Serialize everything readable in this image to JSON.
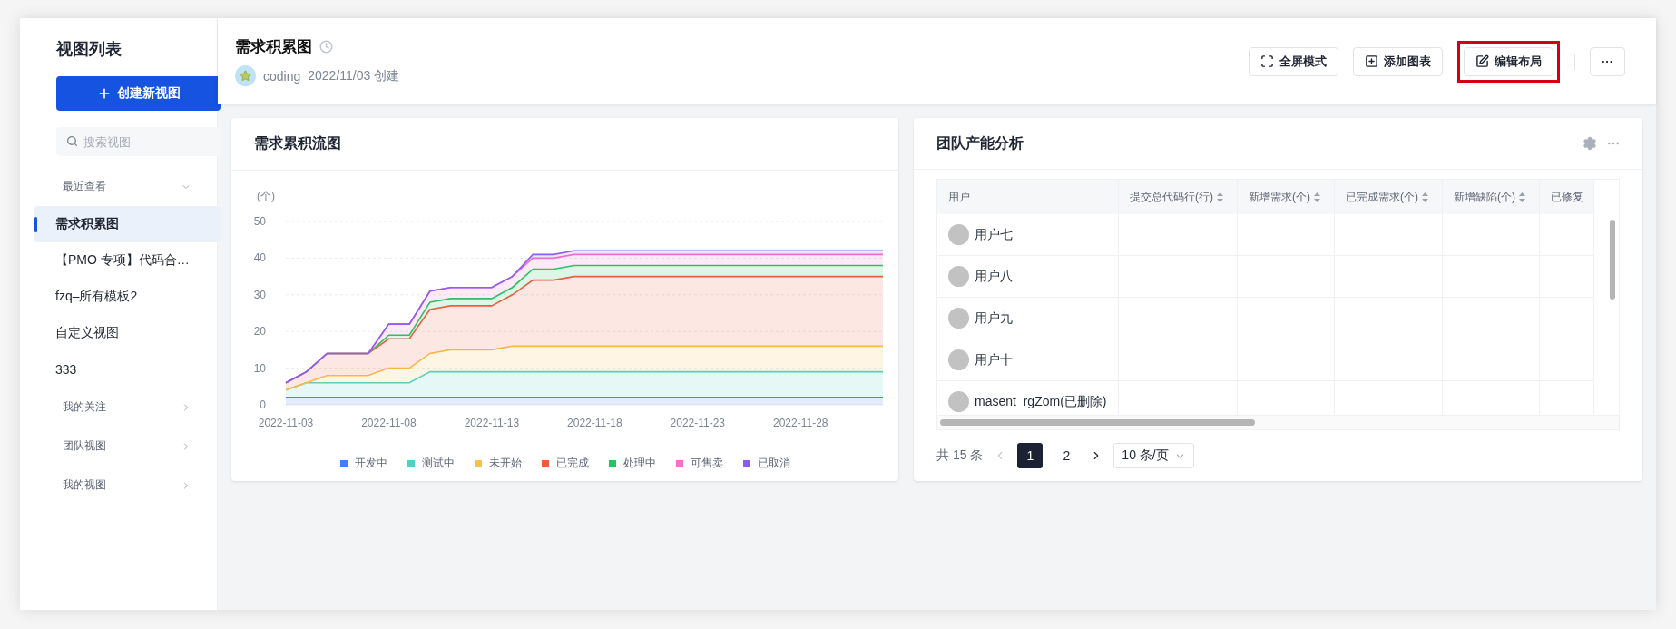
{
  "sidebar": {
    "title": "视图列表",
    "create_button": "创建新视图",
    "search": {
      "placeholder": "搜索视图"
    },
    "sections": [
      {
        "label": "最近查看",
        "expanded": true,
        "items": [
          {
            "label": "需求积累图",
            "selected": true
          },
          {
            "label": "【PMO 专项】代码合…",
            "selected": false
          },
          {
            "label": "fzq–所有模板2",
            "selected": false
          },
          {
            "label": "自定义视图",
            "selected": false
          },
          {
            "label": "333",
            "selected": false
          }
        ]
      },
      {
        "label": "我的关注",
        "expanded": false
      },
      {
        "label": "团队视图",
        "expanded": false
      },
      {
        "label": "我的视图",
        "expanded": false
      }
    ]
  },
  "header": {
    "title": "需求积累图",
    "author": "coding",
    "created": "2022/11/03 创建",
    "buttons": [
      {
        "kind": "fullscreen",
        "label": "全屏模式",
        "highlighted": false
      },
      {
        "kind": "add",
        "label": "添加图表",
        "highlighted": false
      },
      {
        "kind": "edit",
        "label": "编辑布局",
        "highlighted": true
      },
      {
        "kind": "more",
        "label": "···",
        "highlighted": false
      }
    ]
  },
  "chart_card": {
    "title": "需求累积流图",
    "chart_data": {
      "type": "area",
      "stacked": true,
      "grid": true,
      "ylabel": "(个)",
      "ylim": [
        0,
        50
      ],
      "yticks": [
        0,
        10,
        20,
        30,
        40,
        50
      ],
      "xlim": [
        "2022-11-03",
        "2022-12-02"
      ],
      "x": [
        "2022-11-03",
        "2022-11-04",
        "2022-11-05",
        "2022-11-06",
        "2022-11-07",
        "2022-11-08",
        "2022-11-09",
        "2022-11-10",
        "2022-11-11",
        "2022-11-12",
        "2022-11-13",
        "2022-11-14",
        "2022-11-15",
        "2022-11-16",
        "2022-11-17",
        "2022-11-18",
        "2022-11-19",
        "2022-11-20",
        "2022-11-21",
        "2022-11-22",
        "2022-11-23",
        "2022-11-24",
        "2022-11-25",
        "2022-11-26",
        "2022-11-27",
        "2022-11-28",
        "2022-11-29",
        "2022-11-30",
        "2022-12-01",
        "2022-12-02"
      ],
      "xticks": [
        "2022-11-03",
        "2022-11-08",
        "2022-11-13",
        "2022-11-18",
        "2022-11-23",
        "2022-11-28"
      ],
      "series": [
        {
          "name": "开发中",
          "color": "#3b82f6",
          "values": [
            2,
            2,
            2,
            2,
            2,
            2,
            2,
            2,
            2,
            2,
            2,
            2,
            2,
            2,
            2,
            2,
            2,
            2,
            2,
            2,
            2,
            2,
            2,
            2,
            2,
            2,
            2,
            2,
            2,
            2
          ]
        },
        {
          "name": "测试中",
          "color": "#4fd1c5",
          "values": [
            2,
            4,
            4,
            4,
            4,
            4,
            4,
            7,
            7,
            7,
            7,
            7,
            7,
            7,
            7,
            7,
            7,
            7,
            7,
            7,
            7,
            7,
            7,
            7,
            7,
            7,
            7,
            7,
            7,
            7
          ]
        },
        {
          "name": "未开始",
          "color": "#fbbf4a",
          "values": [
            0,
            0,
            2,
            2,
            2,
            4,
            4,
            5,
            6,
            6,
            6,
            7,
            7,
            7,
            7,
            7,
            7,
            7,
            7,
            7,
            7,
            7,
            7,
            7,
            7,
            7,
            7,
            7,
            7,
            7
          ]
        },
        {
          "name": "已完成",
          "color": "#f25c3c",
          "values": [
            2,
            3,
            6,
            6,
            6,
            8,
            8,
            12,
            12,
            12,
            12,
            14,
            18,
            18,
            19,
            19,
            19,
            19,
            19,
            19,
            19,
            19,
            19,
            19,
            19,
            19,
            19,
            19,
            19,
            19
          ]
        },
        {
          "name": "处理中",
          "color": "#22c55e",
          "values": [
            0,
            0,
            0,
            0,
            0,
            1,
            1,
            2,
            2,
            2,
            2,
            2,
            3,
            3,
            3,
            3,
            3,
            3,
            3,
            3,
            3,
            3,
            3,
            3,
            3,
            3,
            3,
            3,
            3,
            3
          ]
        },
        {
          "name": "可售卖",
          "color": "#f472c6",
          "values": [
            0,
            0,
            0,
            0,
            0,
            3,
            3,
            3,
            3,
            3,
            3,
            3,
            3,
            3,
            3,
            3,
            3,
            3,
            3,
            3,
            3,
            3,
            3,
            3,
            3,
            3,
            3,
            3,
            3,
            3
          ]
        },
        {
          "name": "已取消",
          "color": "#8b5cf6",
          "values": [
            0,
            0,
            0,
            0,
            0,
            0,
            0,
            0,
            0,
            0,
            0,
            0,
            1,
            1,
            1,
            1,
            1,
            1,
            1,
            1,
            1,
            1,
            1,
            1,
            1,
            1,
            1,
            1,
            1,
            1
          ]
        }
      ]
    }
  },
  "table_card": {
    "title": "团队产能分析",
    "columns": [
      {
        "label": "用户",
        "sortable": false
      },
      {
        "label": "提交总代码行(行)",
        "sortable": true
      },
      {
        "label": "新增需求(个)",
        "sortable": true
      },
      {
        "label": "已完成需求(个)",
        "sortable": true
      },
      {
        "label": "新增缺陷(个)",
        "sortable": true
      },
      {
        "label": "已修复"
      }
    ],
    "rows": [
      {
        "user": "用户七"
      },
      {
        "user": "用户八"
      },
      {
        "user": "用户九"
      },
      {
        "user": "用户十"
      },
      {
        "user": "masent_rgZom(已删除)"
      }
    ],
    "pagination": {
      "total": "共 15 条",
      "pages": [
        {
          "label": "1",
          "selected": true
        },
        {
          "label": "2",
          "selected": false
        }
      ],
      "page_size": "10 条/页"
    }
  }
}
